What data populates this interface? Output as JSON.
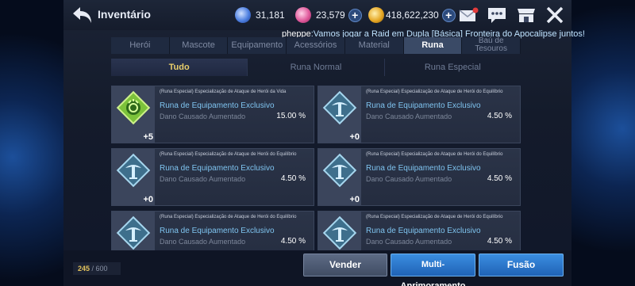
{
  "header": {
    "title": "Inventário",
    "currencies": [
      {
        "icon": "blue-orb-icon",
        "value": "31,181",
        "color": "#4d7fe0",
        "has_plus": false
      },
      {
        "icon": "pink-gem-icon",
        "value": "23,579",
        "color": "#e05a9c",
        "has_plus": true
      },
      {
        "icon": "gold-coin-icon",
        "value": "418,622,230",
        "color": "#e6a825",
        "has_plus": true
      }
    ]
  },
  "chat": {
    "user": "pheppe",
    "message": ":Vamos jogar a Raid em Dupla [Básica] Fronteira do Apocalipse juntos!"
  },
  "tabs": [
    {
      "label": "Herói",
      "active": false
    },
    {
      "label": "Mascote",
      "active": false
    },
    {
      "label": "Equipamento",
      "active": false
    },
    {
      "label": "Acessórios",
      "active": false
    },
    {
      "label": "Material",
      "active": false
    },
    {
      "label": "Runa",
      "active": true
    },
    {
      "label": "Baú de Tesouros",
      "active": false
    }
  ],
  "subtabs": [
    {
      "label": "Tudo",
      "active": true
    },
    {
      "label": "Runa Normal",
      "active": false
    },
    {
      "label": "Runa Especial",
      "active": false
    }
  ],
  "runes": [
    {
      "title": "(Runa Especial) Especialização de Ataque de Herói da Vida",
      "name": "Runa de Equipamento Exclusivo",
      "stat": "Dano Causado Aumentado",
      "value": "15.00 %",
      "level": "+5",
      "icon": "green-life-rune-icon"
    },
    {
      "title": "(Runa Especial) Especialização de Ataque de Herói do Equilíbrio",
      "name": "Runa de Equipamento Exclusivo",
      "stat": "Dano Causado Aumentado",
      "value": "4.50 %",
      "level": "+0",
      "icon": "blue-balance-rune-icon"
    },
    {
      "title": "(Runa Especial) Especialização de Ataque de Herói do Equilíbrio",
      "name": "Runa de Equipamento Exclusivo",
      "stat": "Dano Causado Aumentado",
      "value": "4.50 %",
      "level": "+0",
      "icon": "blue-balance-rune-icon"
    },
    {
      "title": "(Runa Especial) Especialização de Ataque de Herói do Equilíbrio",
      "name": "Runa de Equipamento Exclusivo",
      "stat": "Dano Causado Aumentado",
      "value": "4.50 %",
      "level": "+0",
      "icon": "blue-balance-rune-icon"
    },
    {
      "title": "(Runa Especial) Especialização de Ataque de Herói do Equilíbrio",
      "name": "Runa de Equipamento Exclusivo",
      "stat": "Dano Causado Aumentado",
      "value": "4.50 %",
      "level": "",
      "icon": "blue-balance-rune-icon"
    },
    {
      "title": "(Runa Especial) Especialização de Ataque de Herói do Equilíbrio",
      "name": "Runa de Equipamento Exclusivo",
      "stat": "Dano Causado Aumentado",
      "value": "4.50 %",
      "level": "",
      "icon": "blue-balance-rune-icon"
    }
  ],
  "footer": {
    "capacity_current": "245",
    "capacity_sep": " / ",
    "capacity_max": "600",
    "sell_label": "Vender",
    "multi_label": "Multi-Aprimoramento",
    "fuse_label": "Fusão"
  },
  "colors": {
    "accent_gold": "#e9ce6b",
    "rune_name_blue": "#7fc4f0",
    "button_blue": "#2a78cc",
    "notification_red": "#e23b3b"
  }
}
